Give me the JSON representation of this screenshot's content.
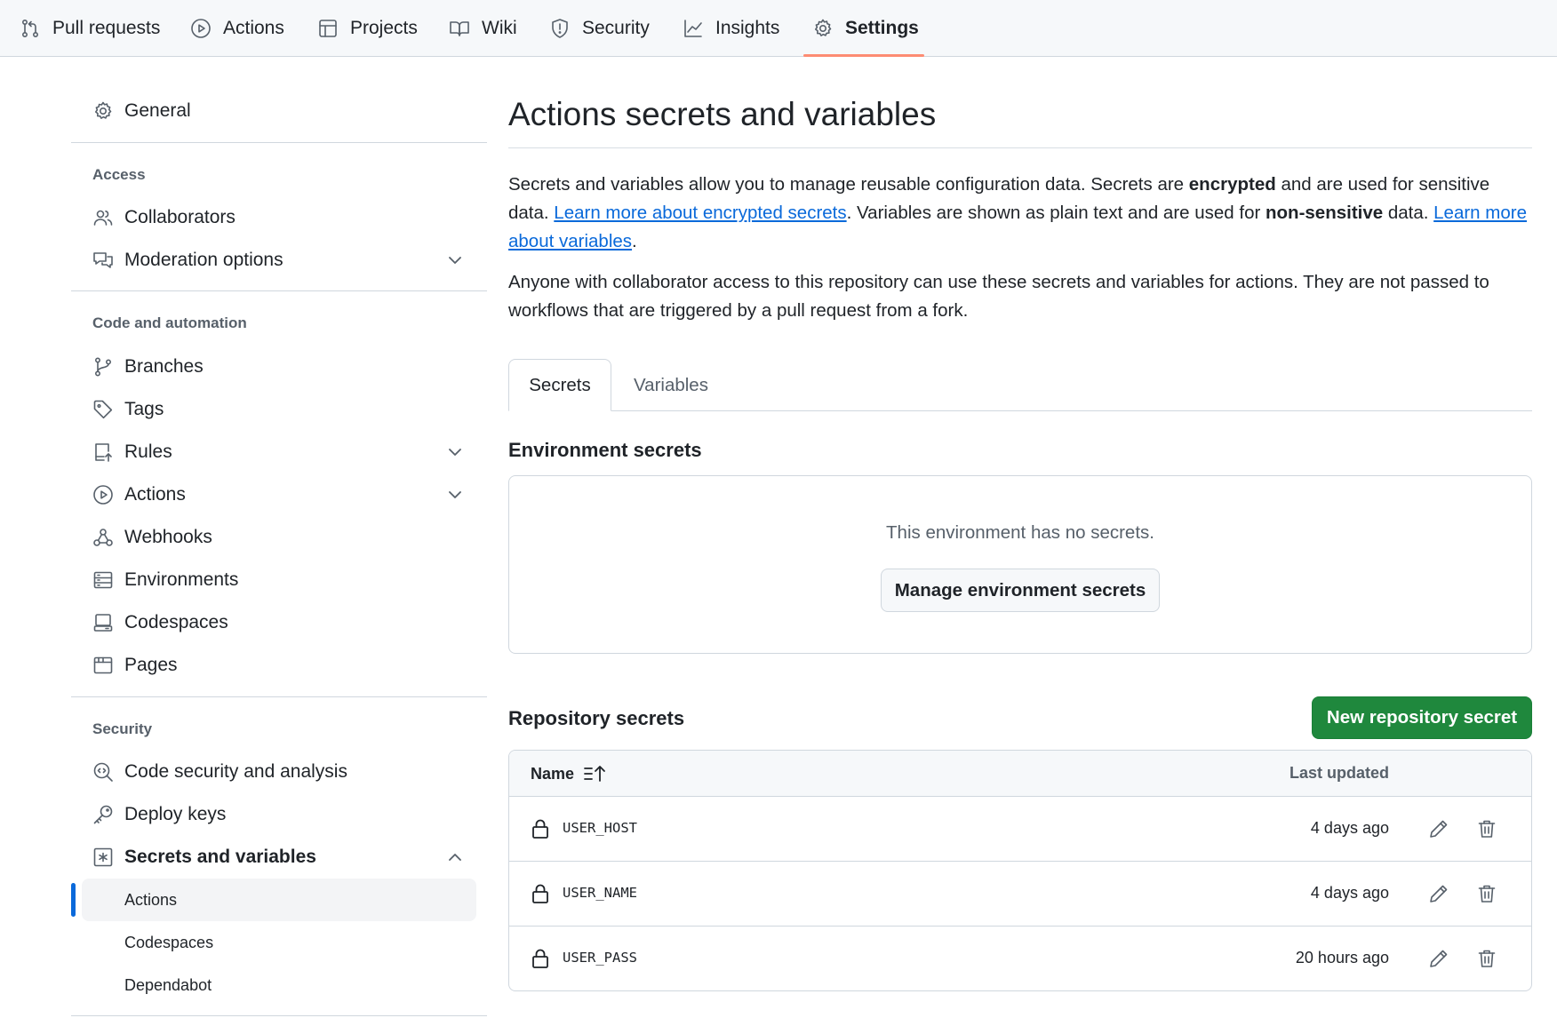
{
  "topnav": {
    "items": [
      {
        "label": "Pull requests",
        "icon": "pull-request-icon"
      },
      {
        "label": "Actions",
        "icon": "play-icon"
      },
      {
        "label": "Projects",
        "icon": "table-icon"
      },
      {
        "label": "Wiki",
        "icon": "book-icon"
      },
      {
        "label": "Security",
        "icon": "shield-icon"
      },
      {
        "label": "Insights",
        "icon": "graph-icon"
      },
      {
        "label": "Settings",
        "icon": "gear-icon",
        "active": true
      }
    ]
  },
  "sidebar": {
    "general": "General",
    "access_heading": "Access",
    "collaborators": "Collaborators",
    "moderation": "Moderation options",
    "code_heading": "Code and automation",
    "branches": "Branches",
    "tags": "Tags",
    "rules": "Rules",
    "actions": "Actions",
    "webhooks": "Webhooks",
    "environments": "Environments",
    "codespaces": "Codespaces",
    "pages": "Pages",
    "security_heading": "Security",
    "code_security": "Code security and analysis",
    "deploy_keys": "Deploy keys",
    "secrets_vars": "Secrets and variables",
    "sub": {
      "actions": "Actions",
      "codespaces": "Codespaces",
      "dependabot": "Dependabot"
    }
  },
  "main": {
    "title": "Actions secrets and variables",
    "intro": {
      "t1": "Secrets and variables allow you to manage reusable configuration data. Secrets are ",
      "b1": "encrypted",
      "t2": " and are used for sensitive data. ",
      "link1": "Learn more about encrypted secrets",
      "t3": ". Variables are shown as plain text and are used for ",
      "b2": "non-sensitive",
      "t4": " data. ",
      "link2": "Learn more about variables",
      "t5": "."
    },
    "access_note": "Anyone with collaborator access to this repository can use these secrets and variables for actions. They are not passed to workflows that are triggered by a pull request from a fork.",
    "tabs": [
      "Secrets",
      "Variables"
    ],
    "env_title": "Environment secrets",
    "env_empty": "This environment has no secrets.",
    "env_button": "Manage environment secrets",
    "repo_title": "Repository secrets",
    "repo_button": "New repository secret",
    "table": {
      "col_name": "Name",
      "col_updated": "Last updated",
      "rows": [
        {
          "name": "USER_HOST",
          "updated": "4 days ago"
        },
        {
          "name": "USER_NAME",
          "updated": "4 days ago"
        },
        {
          "name": "USER_PASS",
          "updated": "20 hours ago"
        }
      ]
    }
  }
}
